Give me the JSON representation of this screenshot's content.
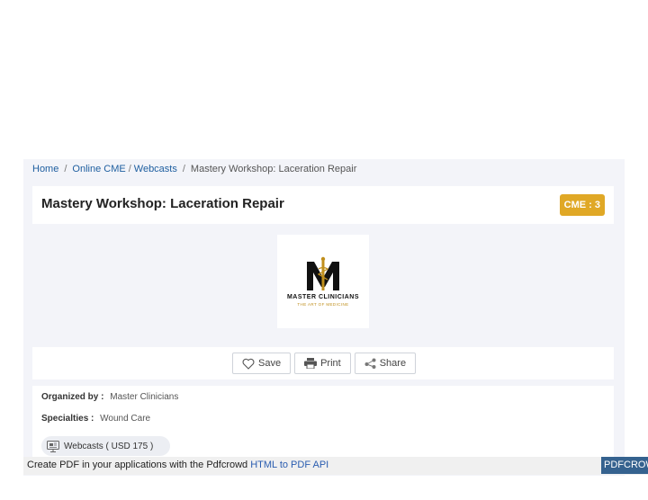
{
  "breadcrumb": {
    "home": "Home",
    "sep1": "/",
    "online_cme": "Online CME",
    "sep2": "/",
    "webcasts": "Webcasts",
    "sep3": "/",
    "current": "Mastery Workshop: Laceration Repair"
  },
  "header": {
    "title": "Mastery Workshop: Laceration Repair",
    "cme_badge": "CME : 3"
  },
  "logo": {
    "name": "MASTER CLINICIANS",
    "tagline": "THE ART OF MEDICINE"
  },
  "actions": {
    "save": "Save",
    "print": "Print",
    "share": "Share"
  },
  "details": {
    "organized_label": "Organized by :",
    "organized_value": "Master Clinicians",
    "specialties_label": "Specialties :",
    "specialties_value": "Wound Care",
    "format_chip": "Webcasts ( USD 175 )"
  },
  "footer": {
    "text": "Create PDF in your applications with the Pdfcrowd",
    "link": "HTML to PDF API",
    "badge": "PDFCROWD"
  },
  "colors": {
    "link": "#1f5fa0",
    "cme_badge": "#e0a826",
    "panel_bg": "#f3f4f9",
    "pdf_badge": "#35628f"
  }
}
